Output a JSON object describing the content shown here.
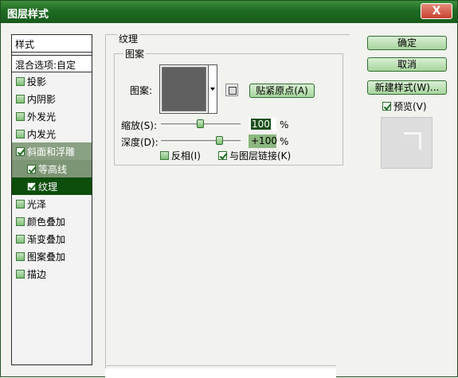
{
  "window": {
    "title": "图层样式",
    "close_label": "X"
  },
  "stylelist": {
    "header": "样式",
    "blend_options": "混合选项:自定",
    "items": [
      {
        "label": "投影",
        "checked": false
      },
      {
        "label": "内阴影",
        "checked": false
      },
      {
        "label": "外发光",
        "checked": false
      },
      {
        "label": "内发光",
        "checked": false
      },
      {
        "label": "斜面和浮雕",
        "checked": true
      },
      {
        "label": "等高线",
        "checked": true
      },
      {
        "label": "纹理",
        "checked": true
      },
      {
        "label": "光泽",
        "checked": false
      },
      {
        "label": "颜色叠加",
        "checked": false
      },
      {
        "label": "渐变叠加",
        "checked": false
      },
      {
        "label": "图案叠加",
        "checked": false
      },
      {
        "label": "描边",
        "checked": false
      }
    ]
  },
  "texture": {
    "group_title": "纹理",
    "pattern_group_title": "图案",
    "pattern_label": "图案:",
    "snap_origin_button": "贴紧原点(A)",
    "scale_label": "缩放(S):",
    "scale_value": "100",
    "scale_unit": "%",
    "scale_level": 100,
    "depth_label": "深度(D):",
    "depth_value": "+100",
    "depth_unit": "%",
    "depth_level": 100,
    "invert_label": "反相(I)",
    "invert_checked": false,
    "link_label": "与图层链接(K)",
    "link_checked": true
  },
  "buttons": {
    "ok": "确定",
    "cancel": "取消",
    "new_style": "新建样式(W)...",
    "preview_label": "预览(V)",
    "preview_checked": true
  },
  "colors": {
    "titlebar": "#1f6a22",
    "accent_green": "#8cb87f",
    "selected_item": "#0c4d0c"
  }
}
